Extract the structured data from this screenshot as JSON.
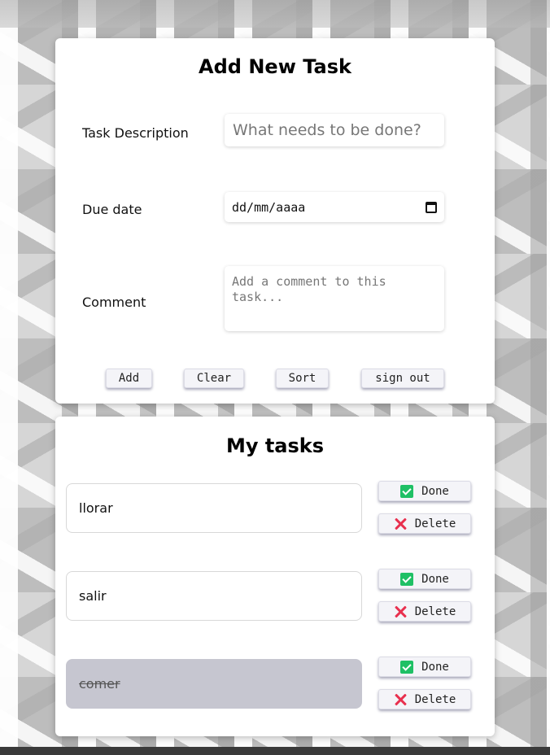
{
  "form": {
    "title": "Add New Task",
    "description_label": "Task Description",
    "description_placeholder": "What needs to be done?",
    "due_label": "Due date",
    "due_value": "dd/mm/aaaa",
    "comment_label": "Comment",
    "comment_placeholder": "Add a comment to this task...",
    "buttons": {
      "add": "Add",
      "clear": "Clear",
      "sort": "Sort",
      "sign_out": "sign out"
    }
  },
  "tasks_section": {
    "title": "My tasks",
    "done_label": "Done",
    "delete_label": "Delete",
    "tasks": [
      {
        "text": "llorar",
        "completed": false
      },
      {
        "text": "salir",
        "completed": false
      },
      {
        "text": "comer",
        "completed": true
      }
    ]
  },
  "colors": {
    "done_icon": "#1fc065",
    "delete_icon": "#e8304e",
    "completed_task_bg": "#c6c6d0"
  },
  "icons": {
    "done": "check-square-icon",
    "delete": "x-icon",
    "calendar": "calendar-icon"
  }
}
